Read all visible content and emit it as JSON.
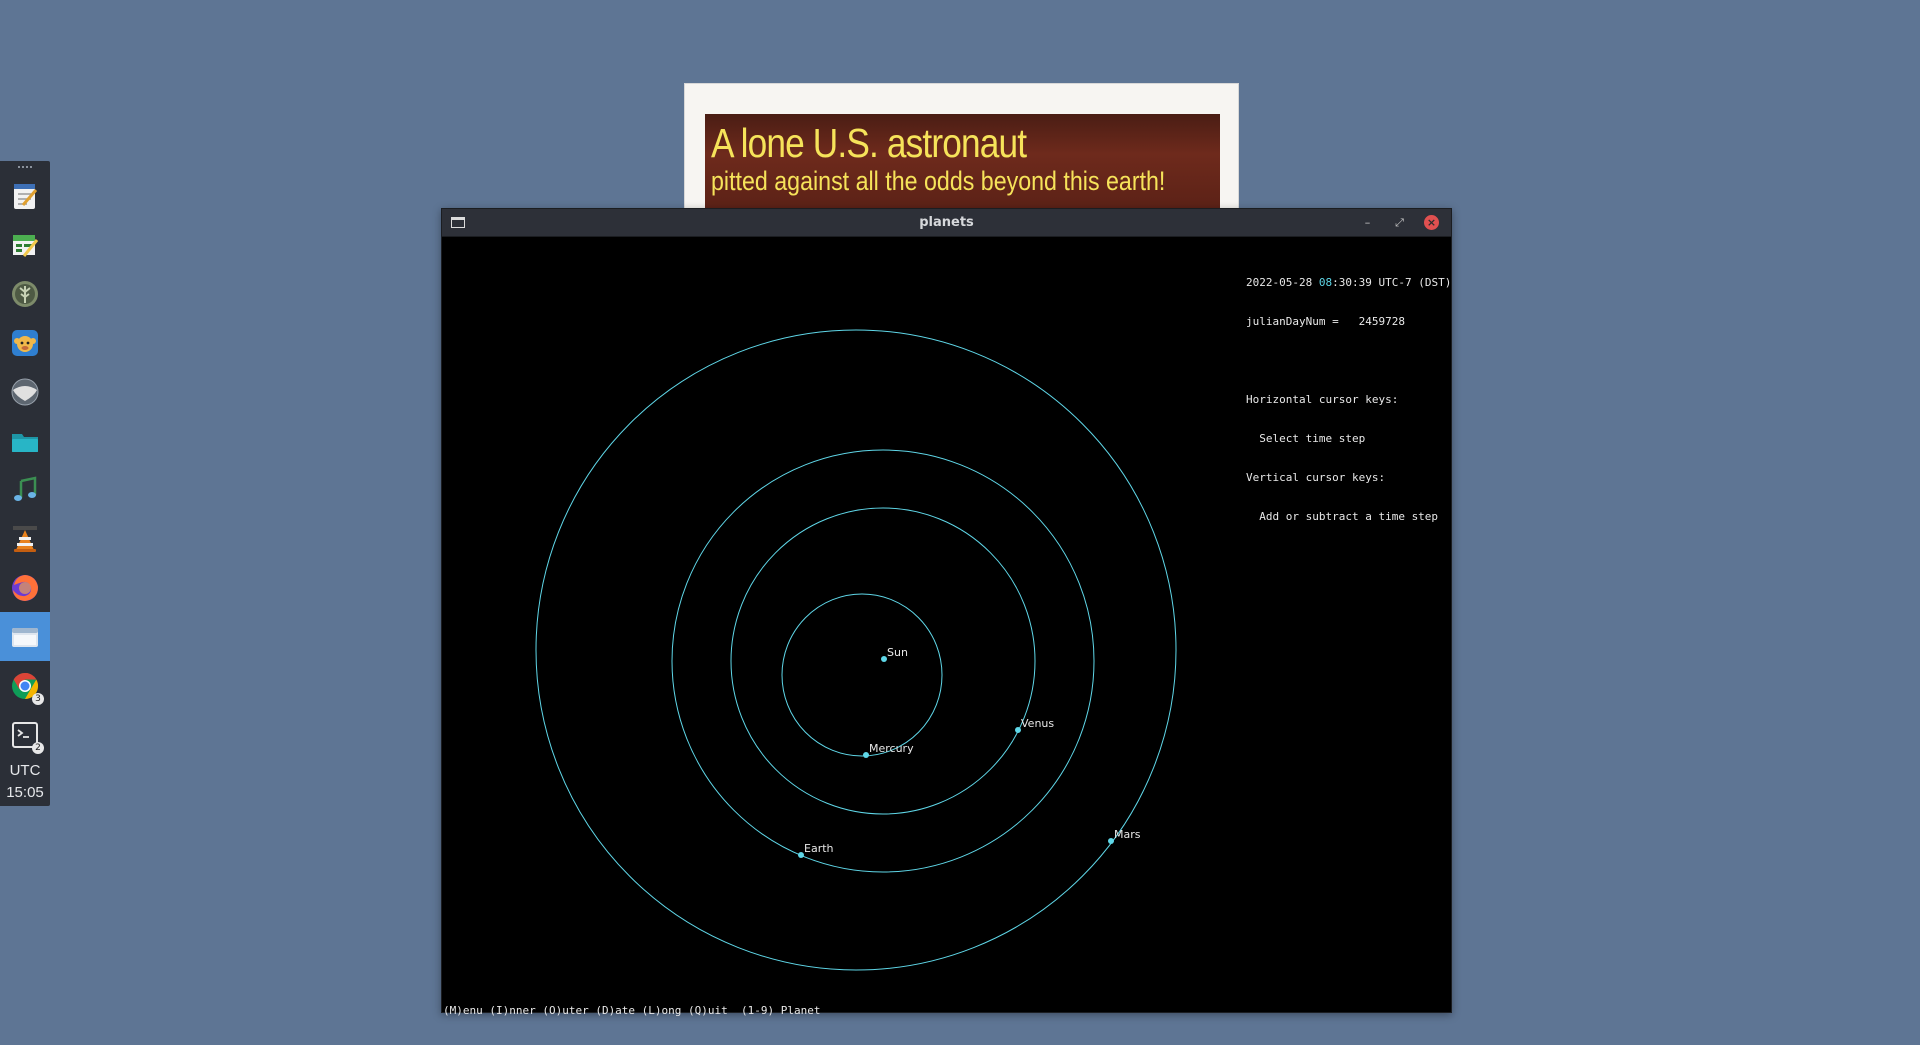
{
  "dock": {
    "items": [
      {
        "name": "text-editor",
        "icon": "notepad-icon",
        "colors": [
          "#f2f2f2",
          "#3d6fb5"
        ]
      },
      {
        "name": "spreadsheet-editor",
        "icon": "spreadsheet-pencil-icon",
        "colors": [
          "#4caf50",
          "#f2c94c"
        ]
      },
      {
        "name": "tree-app",
        "icon": "tree-circle-icon",
        "colors": [
          "#7d8b6a",
          "#c7d1b5"
        ]
      },
      {
        "name": "monkey-app",
        "icon": "monkey-icon",
        "colors": [
          "#2f7fd0",
          "#f0b84a"
        ]
      },
      {
        "name": "cloud-app",
        "icon": "cloud-ball-icon",
        "colors": [
          "#e0e0e0",
          "#5d6670"
        ]
      },
      {
        "name": "files",
        "icon": "folder-icon",
        "colors": [
          "#28b5c6",
          "#1e96a6"
        ]
      },
      {
        "name": "music-app",
        "icon": "music-note-icon",
        "colors": [
          "#3b8f52",
          "#6ab4e6"
        ]
      },
      {
        "name": "vlc",
        "icon": "vlc-cone-icon",
        "colors": [
          "#e8821e",
          "#f2f2f2"
        ]
      },
      {
        "name": "firefox",
        "icon": "firefox-icon",
        "colors": [
          "#ff7139",
          "#6c3bd2"
        ]
      },
      {
        "name": "window",
        "icon": "window-icon",
        "colors": [
          "#dfe6ef",
          "#4a90d9"
        ],
        "active": true
      },
      {
        "name": "chrome",
        "icon": "chrome-icon",
        "colors": [
          "#db4437",
          "#0f9d58"
        ],
        "badge": "3"
      },
      {
        "name": "terminal",
        "icon": "terminal-icon",
        "colors": [
          "#2b2f37",
          "#e6e6e6"
        ],
        "badge": "2"
      }
    ],
    "clock": {
      "zone": "UTC",
      "time": "15:05"
    }
  },
  "poster": {
    "line1": "A lone U.S. astronaut",
    "line2": "pitted against all the odds beyond this earth!"
  },
  "window": {
    "title": "planets",
    "controls": {
      "minimize": "–",
      "maximize": "⤢",
      "close": "×"
    }
  },
  "info": {
    "date": "2022-05-28",
    "time_hour": "08",
    "time_rest": ":30:39 UTC-7 (DST)",
    "julian_line": "julianDayNum =   2459728",
    "help_lines": [
      "Horizontal cursor keys:",
      "  Select time step",
      "Vertical cursor keys:",
      "  Add or subtract a time step"
    ]
  },
  "footer": "(M)enu (I)nner (O)uter (D)ate (L)ong (Q)uit  (1-9) Planet",
  "bodies": [
    {
      "name": "Sun",
      "label": "Sun"
    },
    {
      "name": "Mercury",
      "label": "Mercury"
    },
    {
      "name": "Venus",
      "label": "Venus"
    },
    {
      "name": "Earth",
      "label": "Earth"
    },
    {
      "name": "Mars",
      "label": "Mars"
    }
  ],
  "colors": {
    "orbit": "#5fd7e8",
    "planet": "#5fd7e8",
    "background": "#000000",
    "desktop": "#5e7594"
  }
}
